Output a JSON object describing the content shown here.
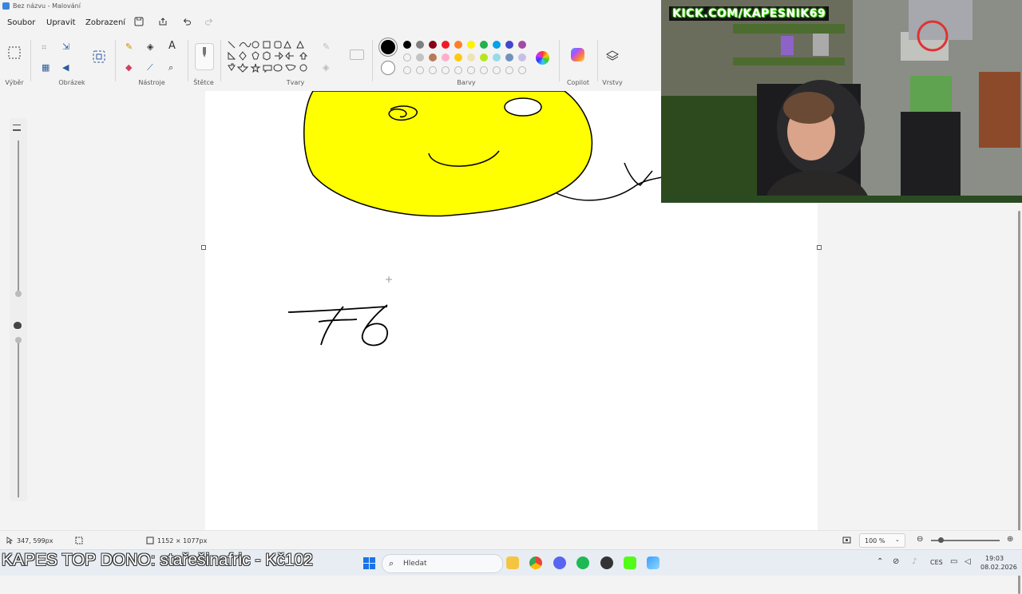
{
  "window": {
    "title": "Bez názvu - Malování"
  },
  "menu": {
    "file": "Soubor",
    "edit": "Upravit",
    "view": "Zobrazení"
  },
  "ribbon": {
    "groups": {
      "selection": "Výběr",
      "image": "Obrázek",
      "tools": "Nástroje",
      "brushes": "Štětce",
      "shapes": "Tvary",
      "colors": "Barvy",
      "copilot": "Copilot",
      "layers": "Vrstvy"
    },
    "palette_row1": [
      "#000000",
      "#7f7f7f",
      "#880015",
      "#ed1c24",
      "#ff7f27",
      "#fff200",
      "#22b14c",
      "#00a2e8",
      "#3f48cc",
      "#a349a4"
    ],
    "palette_row2": [
      "",
      "#c3c3c3",
      "#b97a57",
      "#ffaec9",
      "#ffc90e",
      "#efe4b0",
      "#b5e61d",
      "#99d9ea",
      "#7092be",
      "#c8bfe7"
    ]
  },
  "canvas": {
    "drawn_text": "76"
  },
  "status": {
    "cursor_pos": "347, 599px",
    "canvas_size": "1152 × 1077px",
    "zoom": "100 %"
  },
  "overlay": {
    "donation": "KAPES TOP DONO: stařešinafric - Kč102",
    "stream_url": "KICK.COM/KAPESNIK69"
  },
  "taskbar": {
    "search_placeholder": "Hledat"
  },
  "tray": {
    "language": "CES",
    "time": "19:03",
    "date": "08.02.2026"
  }
}
